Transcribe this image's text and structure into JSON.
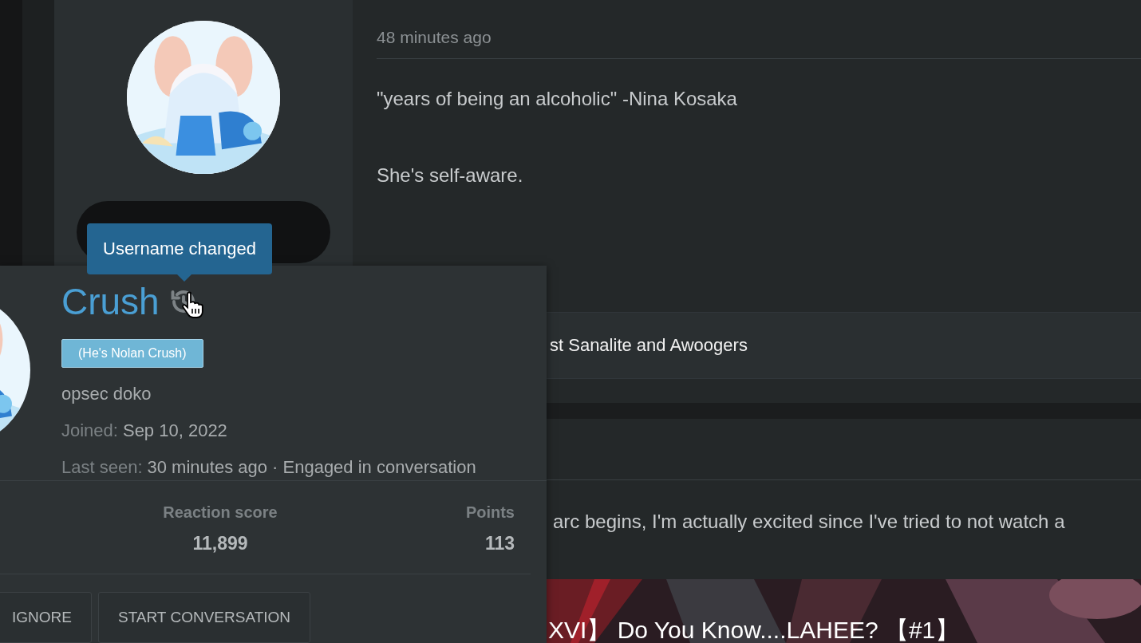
{
  "posts": [
    {
      "time": "48 minutes ago",
      "paragraphs": [
        "\"years of being an alcoholic\" -Nina Kosaka",
        "She's self-aware."
      ],
      "signature": "st Sanalite and Awoogers"
    },
    {
      "text": "arc begins, I'm actually excited since I've tried to not watch a",
      "video": {
        "kind": "picture",
        "title": "XVI】 Do You Know....LAHEE? 【#1】"
      }
    }
  ],
  "tooltip": {
    "text": "Username changed"
  },
  "member_card": {
    "name": "Crush",
    "banner": "(He's Nolan Crush)",
    "user_title": "opsec doko",
    "joined": {
      "label": "Joined:",
      "value": "Sep 10, 2022"
    },
    "last_seen": {
      "label": "Last seen:",
      "value": "30 minutes ago · Engaged in conversation"
    },
    "stats": [
      {
        "label": "Reaction score",
        "value": "11,899"
      },
      {
        "label": "Points",
        "value": "113"
      }
    ],
    "buttons": [
      "IGNORE",
      "START CONVERSATION"
    ]
  }
}
